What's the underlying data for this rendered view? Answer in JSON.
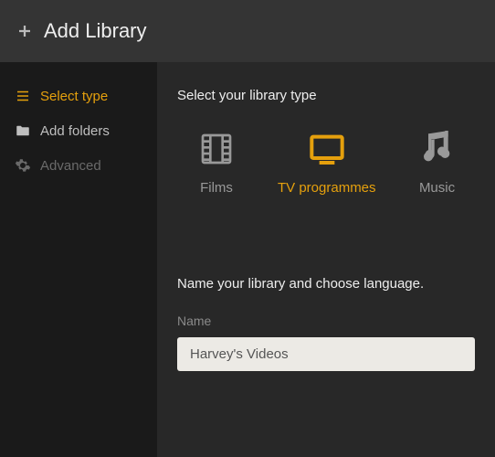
{
  "header": {
    "title": "Add Library"
  },
  "sidebar": {
    "items": [
      {
        "label": "Select type"
      },
      {
        "label": "Add folders"
      },
      {
        "label": "Advanced"
      }
    ]
  },
  "main": {
    "select_type_heading": "Select your library type",
    "types": [
      {
        "label": "Films"
      },
      {
        "label": "TV programmes"
      },
      {
        "label": "Music"
      }
    ],
    "name_prompt": "Name your library and choose language.",
    "name_field_label": "Name",
    "name_value": "Harvey's Videos"
  },
  "colors": {
    "accent": "#e5a00d"
  }
}
